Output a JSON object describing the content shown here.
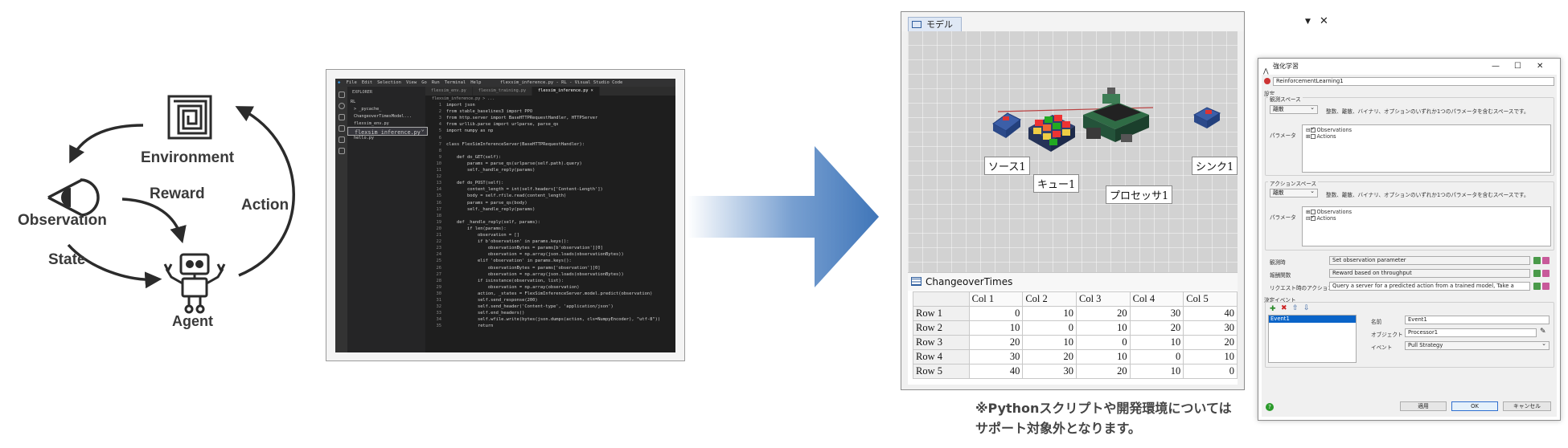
{
  "rl_diagram": {
    "environment": "Environment",
    "reward": "Reward",
    "action": "Action",
    "observation": "Observation",
    "state": "State",
    "agent": "Agent"
  },
  "vscode": {
    "title": "flexsim_inference.py - RL - Visual Studio Code",
    "menu": [
      "File",
      "Edit",
      "Selection",
      "View",
      "Go",
      "Run",
      "Terminal",
      "Help"
    ],
    "explorer_title": "EXPLORER",
    "files": [
      "RL",
      "> _pycache_",
      "ChangeoverTimesModel...",
      "flexsim_env.py",
      "flexsim_inference.py",
      "flexsim_training.py",
      "hello.py"
    ],
    "tabs": [
      "flexsim_env.py",
      "flexsim_training.py",
      "flexsim_inference.py ×"
    ],
    "breadcrumb": "flexsim_inference.py > ...",
    "code": [
      "import json",
      "from stable_baselines3 import PPO",
      "from http.server import BaseHTTPRequestHandler, HTTPServer",
      "from urllib.parse import urlparse, parse_qs",
      "import numpy as np",
      "",
      "class FlexSimInferenceServer(BaseHTTPRequestHandler):",
      "",
      "    def do_GET(self):",
      "        params = parse_qs(urlparse(self.path).query)",
      "        self._handle_reply(params)",
      "",
      "    def do_POST(self):",
      "        content_length = int(self.headers['Content-Length'])",
      "        body = self.rfile.read(content_length)",
      "        params = parse_qs(body)",
      "        self._handle_reply(params)",
      "",
      "    def _handle_reply(self, params):",
      "        if len(params):",
      "            observation = []",
      "            if b'observation' in params.keys():",
      "                observationBytes = params[b'observation'][0]",
      "                observation = np.array(json.loads(observationBytes))",
      "            elif 'observation' in params.keys():",
      "                observationBytes = params['observation'][0]",
      "                observation = np.array(json.loads(observationBytes))",
      "            if isinstance(observation, list):",
      "                observation = np.array(observation)",
      "            action, _states = FlexSimInferenceServer.model.predict(observation)",
      "            self.send_response(200)",
      "            self.send_header('Content-type', 'application/json')",
      "            self.end_headers()",
      "            self.wfile.write(bytes(json.dumps(action, cls=NumpyEncoder), \"utf-8\"))",
      "            return"
    ]
  },
  "model_window": {
    "tab_label": "モデル",
    "objects": {
      "source": "ソース1",
      "queue": "キュー1",
      "processor": "プロセッサ1",
      "sink": "シンク1"
    },
    "table": {
      "title": "ChangeoverTimes",
      "columns": [
        "Col 1",
        "Col 2",
        "Col 3",
        "Col 4",
        "Col 5"
      ],
      "rows": [
        {
          "name": "Row 1",
          "values": [
            "0",
            "10",
            "20",
            "30",
            "40"
          ]
        },
        {
          "name": "Row 2",
          "values": [
            "10",
            "0",
            "10",
            "20",
            "30"
          ]
        },
        {
          "name": "Row 3",
          "values": [
            "20",
            "10",
            "0",
            "10",
            "20"
          ]
        },
        {
          "name": "Row 4",
          "values": [
            "30",
            "20",
            "10",
            "0",
            "10"
          ]
        },
        {
          "name": "Row 5",
          "values": [
            "40",
            "30",
            "20",
            "10",
            "0"
          ]
        }
      ]
    }
  },
  "note": {
    "line1": "※Pythonスクリプトや開発環境については",
    "line2": "サポート対象外となります。"
  },
  "dialog": {
    "title": "強化学習",
    "name": "ReinforcementLearning1",
    "section_settings": "設定",
    "obs_space_label": "観測スペース",
    "obs_space_value": "離散",
    "obs_space_desc": "整数、離散、バイナリ、オプションのいずれか1つのパラメータを含むスペースです。",
    "params_label": "パラメータ",
    "obs_tree": [
      "Observations",
      "Actions"
    ],
    "action_space_label": "アクションスペース",
    "action_space_value": "離散",
    "action_space_desc": "整数、離散、バイナリ、オプションのいずれか1つのパラメータを含むスペースです。",
    "action_tree": [
      "Observations",
      "Actions"
    ],
    "observation_func_label": "観測時",
    "observation_func_value": "Set observation parameter",
    "reward_func_label": "報酬関数",
    "reward_func_value": "Reward based on throughput",
    "request_action_label": "リクエスト時のアクション",
    "request_action_value": "Query a server for a predicted action from a trained model, Take a",
    "decision_events_label": "決定イベント",
    "event_list": [
      "Event1"
    ],
    "event_name_label": "名前",
    "event_name_value": "Event1",
    "event_object_label": "オブジェクト",
    "event_object_value": "Processor1",
    "event_event_label": "イベント",
    "event_event_value": "Pull Strategy",
    "btn_apply": "適用",
    "btn_ok": "OK",
    "btn_cancel": "キャンセル"
  },
  "colors": {
    "arrow": "#4a7fc1",
    "diagram_stroke": "#2b2b2b",
    "vscode_bg": "#1e1e1e"
  }
}
